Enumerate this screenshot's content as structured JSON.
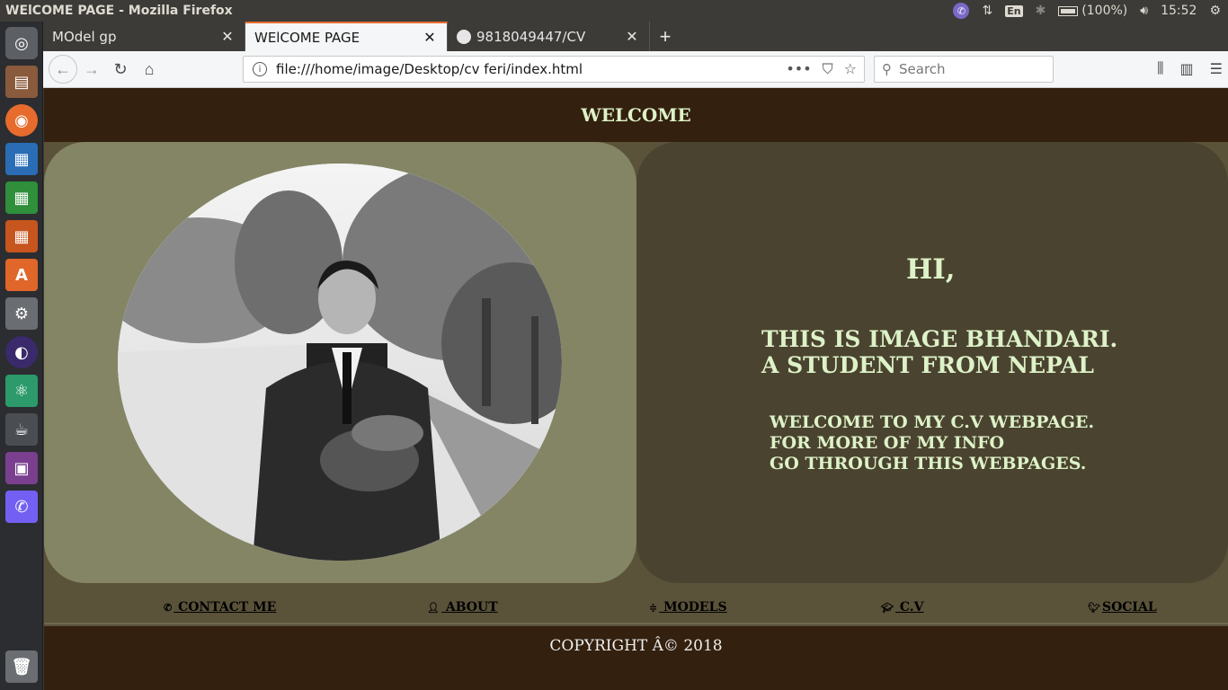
{
  "os": {
    "window_title": "WElCOME PAGE - Mozilla Firefox",
    "tray": {
      "keyboard": "En",
      "battery": "(100%)",
      "time": "15:52"
    }
  },
  "browser": {
    "tabs": [
      {
        "label": "MOdel gp",
        "active": false
      },
      {
        "label": "WElCOME PAGE",
        "active": true
      },
      {
        "label": "9818049447/CV",
        "active": false
      }
    ],
    "url": "file:///home/image/Desktop/cv feri/index.html",
    "search_placeholder": "Search"
  },
  "page": {
    "header_title": "WELCOME",
    "hi": "HI,",
    "intro_lines": [
      "THIS IS IMAGE BHANDARI.",
      "A STUDENT FROM NEPAL"
    ],
    "welcome_lines": [
      "WELCOME TO MY C.V WEBPAGE.",
      "FOR MORE OF MY INFO",
      "GO THROUGH THIS WEBPAGES."
    ],
    "nav_links": [
      {
        "label": " CONTACT ME",
        "icon": "phone-icon"
      },
      {
        "label": " ABOUT",
        "icon": "user-icon"
      },
      {
        "label": " MODELS",
        "icon": "sliders-icon"
      },
      {
        "label": " C.V",
        "icon": "graduation-cap-icon"
      },
      {
        "label": "SOCIAL",
        "icon": "twitter-icon"
      }
    ],
    "copyright": "COPYRIGHT Â© 2018"
  },
  "colors": {
    "header_bg": "#33200e",
    "accent_text": "#ddf2c8",
    "left_panel": "#838565",
    "right_panel": "#4a432f",
    "page_bg": "#5a5239"
  }
}
